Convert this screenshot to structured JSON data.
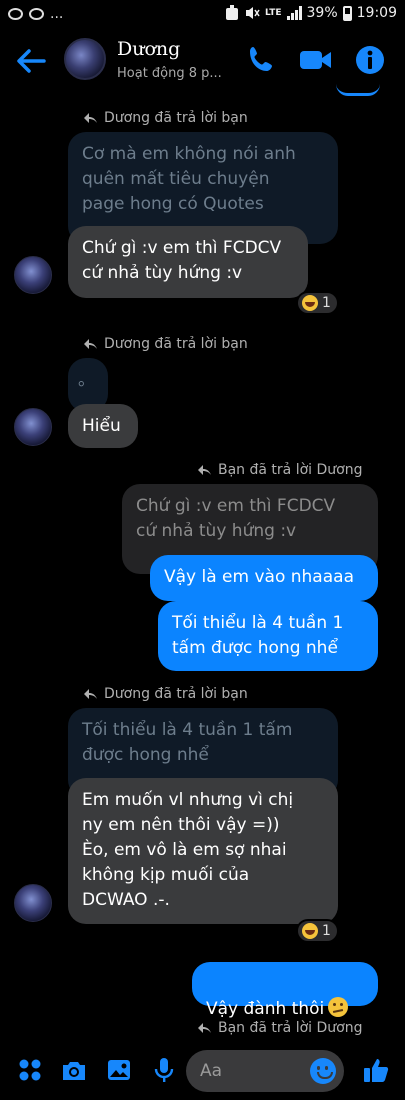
{
  "status_bar": {
    "battery": "39%",
    "time": "19:09",
    "network": "LTE",
    "dots": "..."
  },
  "header": {
    "contact_name": "Dương",
    "contact_status": "Hoạt động 8 p...",
    "icons": [
      "back-arrow-icon",
      "phone-icon",
      "video-camera-icon",
      "info-icon"
    ],
    "accent_color": "#1787fb"
  },
  "messages": {
    "note_1": "Dương đã trả lời bạn",
    "quote_1": "Cơ mà em không nói anh\nquên mất tiêu chuyện\npage hong có Quotes",
    "msg_1": "Chứ gì :v em thì FCDCV\ncứ nhả tùy hứng :v",
    "reaction_1_count": "1",
    "note_2": "Dương đã trả lời bạn",
    "quote_2": "。",
    "msg_2": "Hiểu",
    "note_3": "Bạn đã trả lời Dương",
    "quote_3": "Chứ gì :v em thì FCDCV\ncứ nhả tùy hứng :v",
    "msg_3": "Vậy là em vào nhaaaa",
    "msg_4": "Tối thiểu là 4 tuần 1\ntấm được hong nhể",
    "note_4": "Dương đã trả lời bạn",
    "quote_4": "Tối thiểu là 4 tuần 1 tấm\nđược hong nhể",
    "msg_5": "Em muốn vl nhưng vì chị\nny em nên thôi vậy =))\nÈo, em vô là em sợ nhai\nkhông kịp muối của\nDCWAO .-.",
    "reaction_2_count": "1",
    "msg_6": "Vậy đành thôi",
    "note_5": "Bạn đã trả lời Dương",
    "colors": {
      "outgoing": "#0b84ff",
      "incoming": "#3a3b3d"
    }
  },
  "composer": {
    "placeholder": "Aa",
    "icons": [
      "menu-dots-icon",
      "camera-icon",
      "gallery-icon",
      "microphone-icon",
      "emoji-icon",
      "thumbs-up-icon"
    ]
  }
}
